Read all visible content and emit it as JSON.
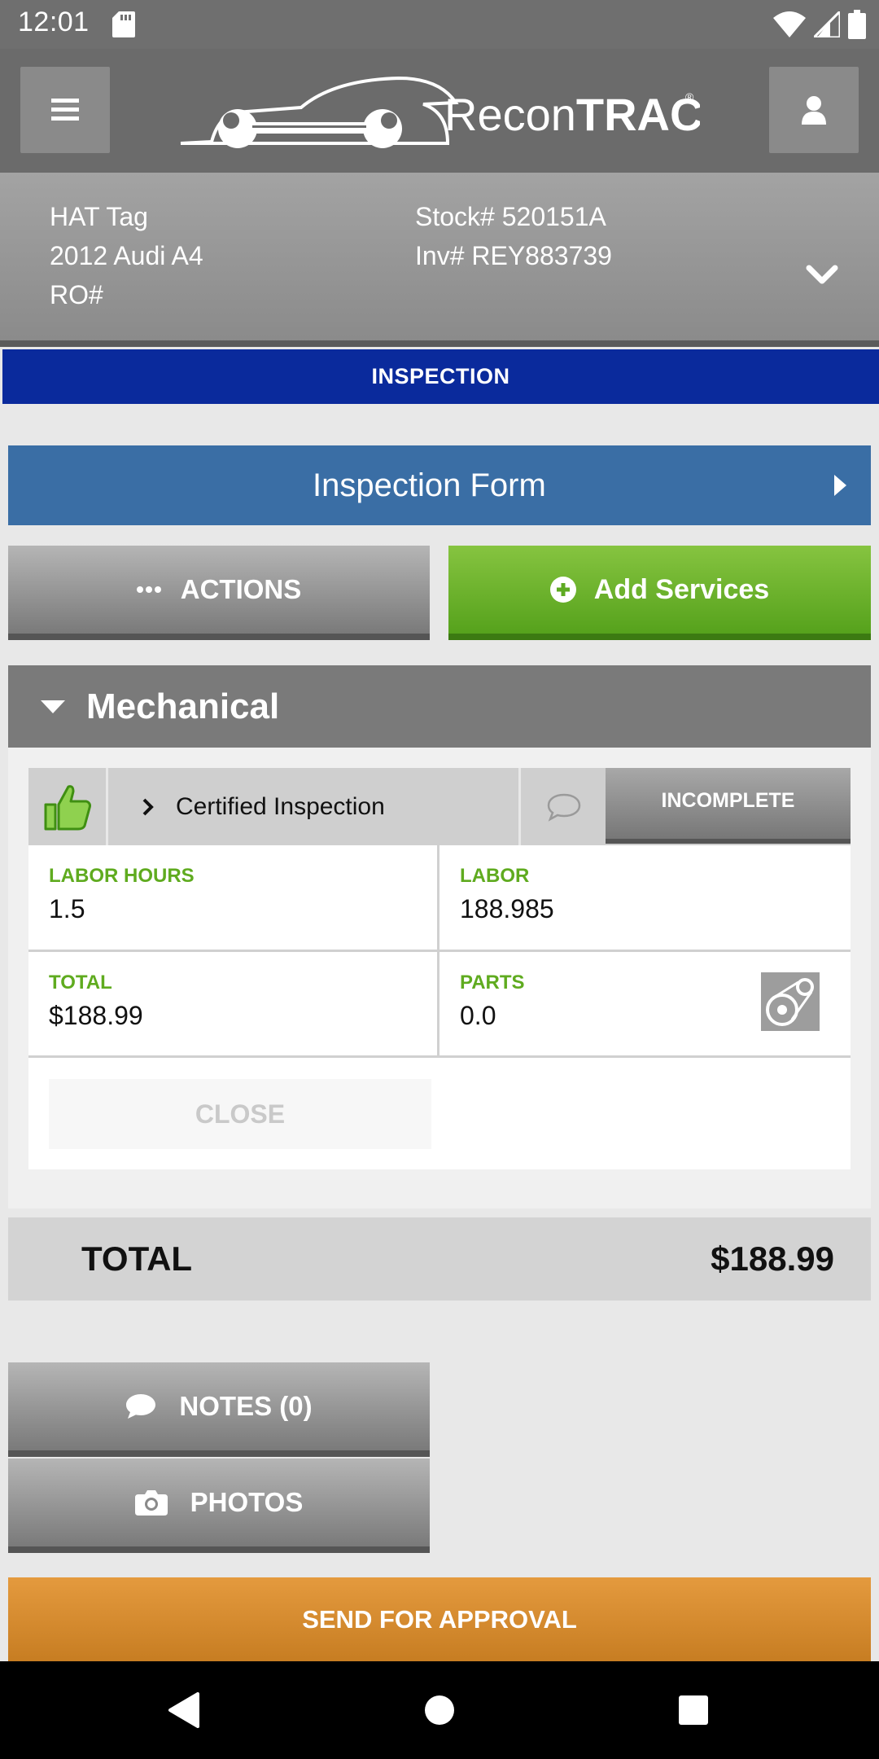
{
  "status_bar": {
    "time": "12:01"
  },
  "header": {
    "logo_text_light": "Recon",
    "logo_text_bold": "TRAC",
    "logo_mark": "®"
  },
  "vehicle": {
    "tag": "HAT Tag",
    "model": "2012 Audi A4",
    "ro": "RO#",
    "stock": "Stock# 520151A",
    "inv": "Inv# REY883739"
  },
  "stage": {
    "label": "INSPECTION"
  },
  "inspection_form": {
    "label": "Inspection Form"
  },
  "toolbar": {
    "actions_label": "ACTIONS",
    "add_services_label": "Add Services"
  },
  "section": {
    "title": "Mechanical",
    "service": {
      "name": "Certified Inspection",
      "status": "INCOMPLETE",
      "labor_hours_label": "LABOR HOURS",
      "labor_hours": "1.5",
      "labor_label": "LABOR",
      "labor": "188.985",
      "total_label": "TOTAL",
      "total": "$188.99",
      "parts_label": "PARTS",
      "parts": "0.0",
      "close_label": "CLOSE"
    }
  },
  "summary": {
    "total_label": "TOTAL",
    "total_value": "$188.99"
  },
  "bottom": {
    "notes_label": "NOTES (0)",
    "photos_label": "PHOTOS",
    "approval_label": "SEND FOR APPROVAL"
  },
  "colors": {
    "stage_bar": "#0a2a9c",
    "form_button": "#3a6ea5",
    "add_services": "#6ab12c",
    "approval": "#d98c30",
    "field_label": "#5fab1f"
  }
}
